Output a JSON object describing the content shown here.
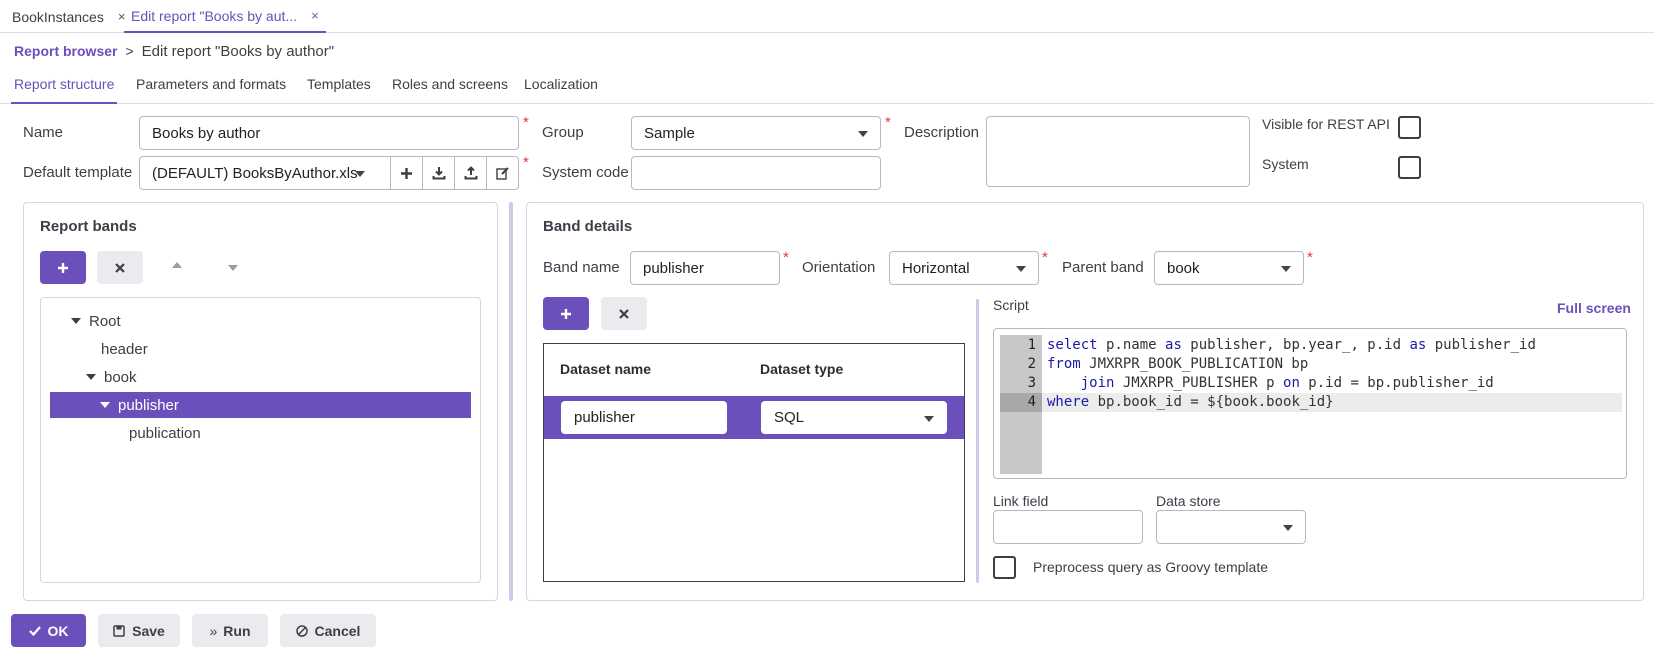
{
  "top_tabs": [
    {
      "label": "BookInstances",
      "close": "×"
    },
    {
      "label": "Edit report \"Books by aut...",
      "close": "×"
    }
  ],
  "breadcrumb": {
    "link": "Report browser",
    "separator": ">",
    "current": "Edit report \"Books by author\""
  },
  "content_tabs": [
    "Report structure",
    "Parameters and formats",
    "Templates",
    "Roles and screens",
    "Localization"
  ],
  "form": {
    "name_label": "Name",
    "name_value": "Books by author",
    "default_template_label": "Default template",
    "default_template_value": "(DEFAULT) BooksByAuthor.xls",
    "group_label": "Group",
    "group_value": "Sample",
    "system_code_label": "System code",
    "system_code_value": "",
    "description_label": "Description",
    "description_value": "",
    "visible_rest_label": "Visible for REST API",
    "system_label": "System",
    "required_mark": "*"
  },
  "report_bands": {
    "title": "Report bands",
    "add_icon": "plus-icon",
    "remove_icon": "close-icon",
    "tree": [
      {
        "label": "Root",
        "level": 0,
        "expanded": true
      },
      {
        "label": "header",
        "level": 1,
        "expanded": null
      },
      {
        "label": "book",
        "level": 1,
        "expanded": true
      },
      {
        "label": "publisher",
        "level": 2,
        "expanded": true,
        "selected": true
      },
      {
        "label": "publication",
        "level": 3,
        "expanded": null
      }
    ]
  },
  "band_details": {
    "title": "Band details",
    "band_name_label": "Band name",
    "band_name_value": "publisher",
    "orientation_label": "Orientation",
    "orientation_value": "Horizontal",
    "parent_band_label": "Parent band",
    "parent_band_value": "book",
    "datasets": {
      "col_name": "Dataset name",
      "col_type": "Dataset type",
      "rows": [
        {
          "name": "publisher",
          "type": "SQL"
        }
      ]
    },
    "script": {
      "label": "Script",
      "full_screen": "Full screen",
      "line_numbers": [
        "1",
        "2",
        "3",
        "4"
      ]
    },
    "link_field_label": "Link field",
    "link_field_value": "",
    "data_store_label": "Data store",
    "data_store_value": "",
    "preprocess_label": "Preprocess query as Groovy template"
  },
  "footer": {
    "ok": "OK",
    "save": "Save",
    "run": "Run",
    "cancel": "Cancel"
  },
  "colors": {
    "accent": "#6b4fbb",
    "required": "#e23b3b"
  }
}
